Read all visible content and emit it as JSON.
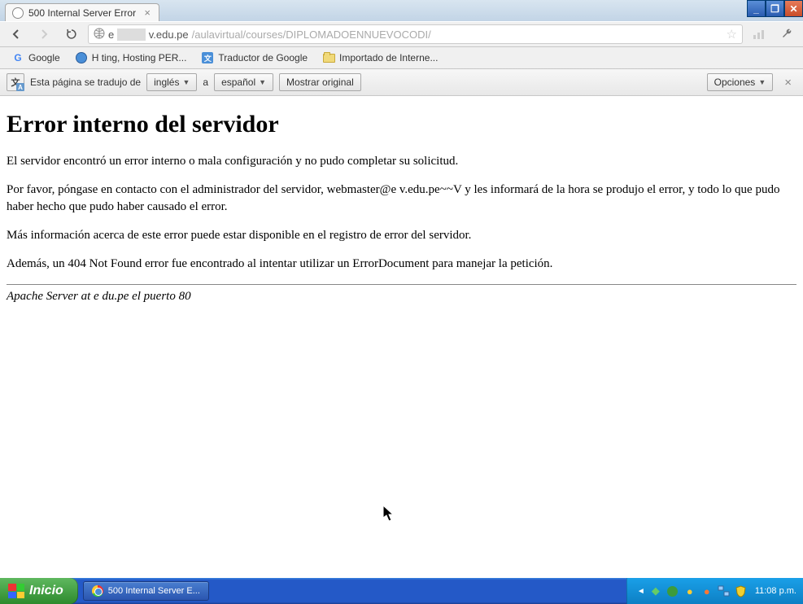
{
  "tab": {
    "title": "500 Internal Server Error"
  },
  "address": {
    "host_prefix": "e",
    "host_suffix": "v.edu.pe",
    "path": "/aulavirtual/courses/DIPLOMADOENNUEVOCODI/"
  },
  "bookmarks": [
    {
      "label": "Google",
      "icon": "google"
    },
    {
      "label": "H   ting, Hosting PER...",
      "icon": "globe"
    },
    {
      "label": "Traductor de Google",
      "icon": "translate"
    },
    {
      "label": "Importado de Interne...",
      "icon": "folder"
    }
  ],
  "translate": {
    "prefix": "Esta página se tradujo de",
    "from": "inglés",
    "sep": "a",
    "to": "español",
    "show_original": "Mostrar original",
    "options": "Opciones"
  },
  "page": {
    "heading": "Error interno del servidor",
    "p1": "El servidor encontró un error interno o mala configuración y no pudo completar su solicitud.",
    "p2": "Por favor, póngase en contacto con el administrador del servidor, webmaster@e        v.edu.pe~~V y les informará de la hora se produjo el error, y todo lo que pudo haber hecho que pudo haber causado el error.",
    "p3": "Más información acerca de este error puede estar disponible en el registro de error del servidor.",
    "p4": "Además, un 404 Not Found error fue encontrado al intentar utilizar un ErrorDocument para manejar la petición.",
    "footer": "Apache Server at e           du.pe el puerto 80"
  },
  "taskbar": {
    "start": "Inicio",
    "task": "500 Internal Server E...",
    "clock": "11:08 p.m."
  }
}
